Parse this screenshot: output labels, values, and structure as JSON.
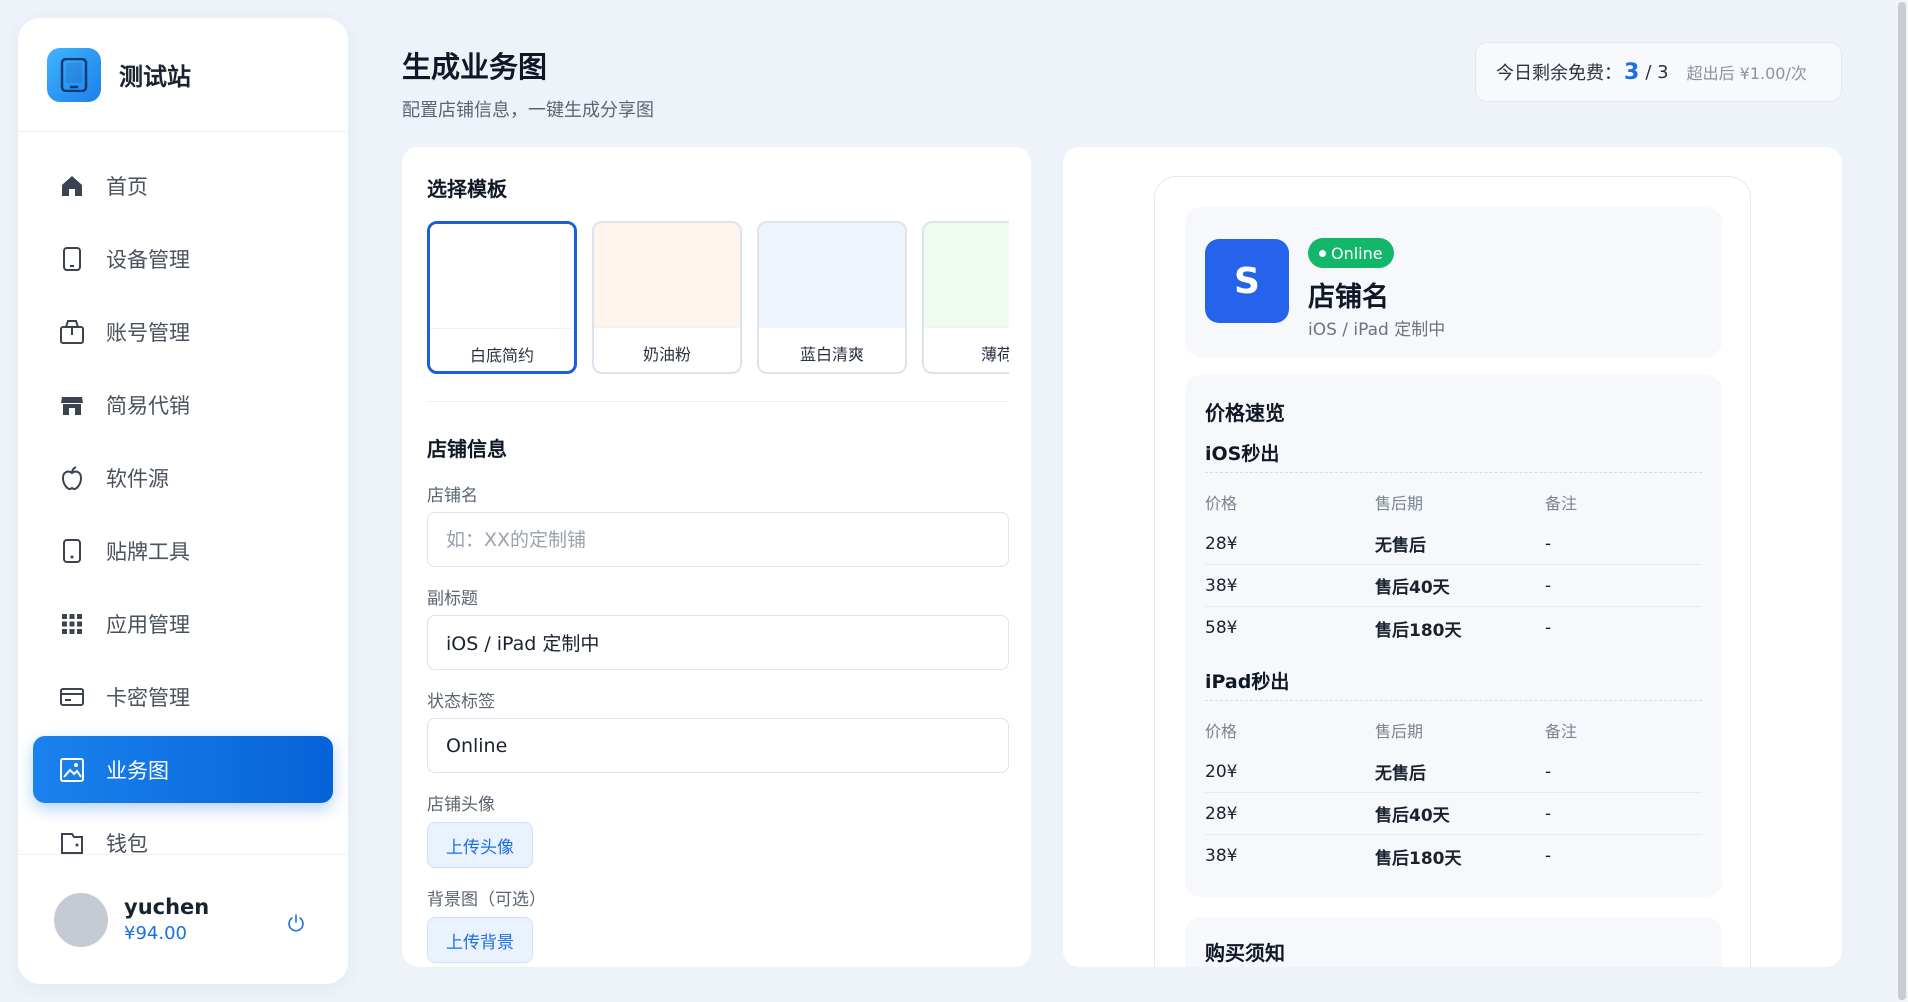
{
  "app": {
    "brand_name": "测试站"
  },
  "sidebar": {
    "items": [
      {
        "label": "首页",
        "icon": "home-icon"
      },
      {
        "label": "设备管理",
        "icon": "device-icon"
      },
      {
        "label": "账号管理",
        "icon": "box-icon"
      },
      {
        "label": "简易代销",
        "icon": "store-icon"
      },
      {
        "label": "软件源",
        "icon": "apple-icon"
      },
      {
        "label": "贴牌工具",
        "icon": "tablet-icon"
      },
      {
        "label": "应用管理",
        "icon": "grid-icon"
      },
      {
        "label": "卡密管理",
        "icon": "card-icon"
      },
      {
        "label": "业务图",
        "icon": "image-icon",
        "active": true
      },
      {
        "label": "钱包",
        "icon": "wallet-icon"
      }
    ],
    "user": {
      "name": "yuchen",
      "balance": "¥94.00"
    }
  },
  "header": {
    "title": "生成业务图",
    "subtitle": "配置店铺信息，一键生成分享图"
  },
  "quota": {
    "label": "今日剩余免费：",
    "used": "3",
    "total": "/ 3",
    "extra": "超出后 ¥1.00/次"
  },
  "config": {
    "template_section_title": "选择模板",
    "templates": [
      {
        "name": "白底简约",
        "swatch": "#ffffff",
        "selected": true
      },
      {
        "name": "奶油粉",
        "swatch": "#fdf4ee"
      },
      {
        "name": "蓝白清爽",
        "swatch": "#edf4fe"
      },
      {
        "name": "薄荷",
        "swatch": "#eefbf1"
      }
    ],
    "store_section_title": "店铺信息",
    "fields": {
      "store_name": {
        "label": "店铺名",
        "value": "",
        "placeholder": "如：XX的定制铺"
      },
      "subtitle": {
        "label": "副标题",
        "value": "iOS / iPad 定制中",
        "placeholder": ""
      },
      "status_tag": {
        "label": "状态标签",
        "value": "Online",
        "placeholder": ""
      }
    },
    "avatar": {
      "label": "店铺头像",
      "button": "上传头像"
    },
    "background": {
      "label": "背景图（可选）",
      "button": "上传背景"
    }
  },
  "preview": {
    "avatar_letter": "S",
    "status_badge": "Online",
    "store_name": "店铺名",
    "store_subtitle": "iOS / iPad 定制中",
    "price_title": "价格速览",
    "groups": [
      {
        "title": "iOS秒出",
        "headers": [
          "价格",
          "售后期",
          "备注"
        ],
        "rows": [
          [
            "28¥",
            "无售后",
            "-"
          ],
          [
            "38¥",
            "售后40天",
            "-"
          ],
          [
            "58¥",
            "售后180天",
            "-"
          ]
        ]
      },
      {
        "title": "iPad秒出",
        "headers": [
          "价格",
          "售后期",
          "备注"
        ],
        "rows": [
          [
            "20¥",
            "无售后",
            "-"
          ],
          [
            "28¥",
            "售后40天",
            "-"
          ],
          [
            "38¥",
            "售后180天",
            "-"
          ]
        ]
      }
    ],
    "notice_title": "购买须知"
  },
  "colors": {
    "accent": "#1c6fe0",
    "active_nav": "#0a6ae4",
    "badge_green": "#12b76a",
    "avatar_blue": "#2563eb"
  }
}
